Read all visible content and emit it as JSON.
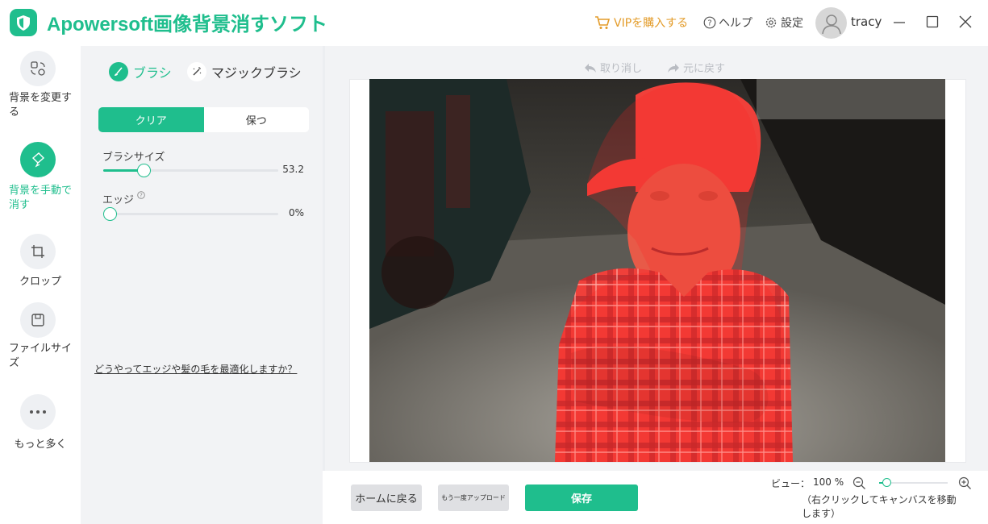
{
  "titlebar": {
    "app_title": "Apowersoft画像背景消すソフト",
    "vip_label": "VIPを購入する",
    "help_label": "ヘルプ",
    "settings_label": "設定",
    "username": "tracy"
  },
  "leftnav": {
    "items": [
      {
        "label": "背景を変更する",
        "icon": "change-background-icon",
        "active": false
      },
      {
        "label": "背景を手動で消す",
        "icon": "manual-erase-icon",
        "active": true
      },
      {
        "label": "クロップ",
        "icon": "crop-icon",
        "active": false
      },
      {
        "label": "ファイルサイズ",
        "icon": "file-size-icon",
        "active": false
      },
      {
        "label": "もっと多く",
        "icon": "more-icon",
        "active": false
      }
    ]
  },
  "toolpanel": {
    "tabs": [
      {
        "label": "ブラシ",
        "icon": "brush-icon",
        "active": true
      },
      {
        "label": "マジックブラシ",
        "icon": "magic-wand-icon",
        "active": false
      }
    ],
    "mode": {
      "clear_label": "クリア",
      "keep_label": "保つ",
      "selected": "クリア"
    },
    "brush_size": {
      "label": "ブラシサイズ",
      "value": "53.2",
      "fraction": 0.23
    },
    "edge": {
      "label": "エッジ",
      "value": "0%",
      "fraction": 0
    },
    "hint_link": "どうやってエッジや髪の毛を最適化しますか？"
  },
  "canvas": {
    "undo_label": "取り消し",
    "redo_label": "元に戻す"
  },
  "bottombar": {
    "home_label": "ホームに戻る",
    "reupload_label": "もう一度アップロード",
    "save_label": "保存",
    "view_label": "ビュー：",
    "zoom_value": "100 %",
    "zoom_fraction": 0.05,
    "view_hint": "（右クリックしてキャンバスを移動します）"
  },
  "colors": {
    "accent": "#1fbe8d",
    "vip": "#e39b28",
    "mask": "#ff1e1e"
  }
}
